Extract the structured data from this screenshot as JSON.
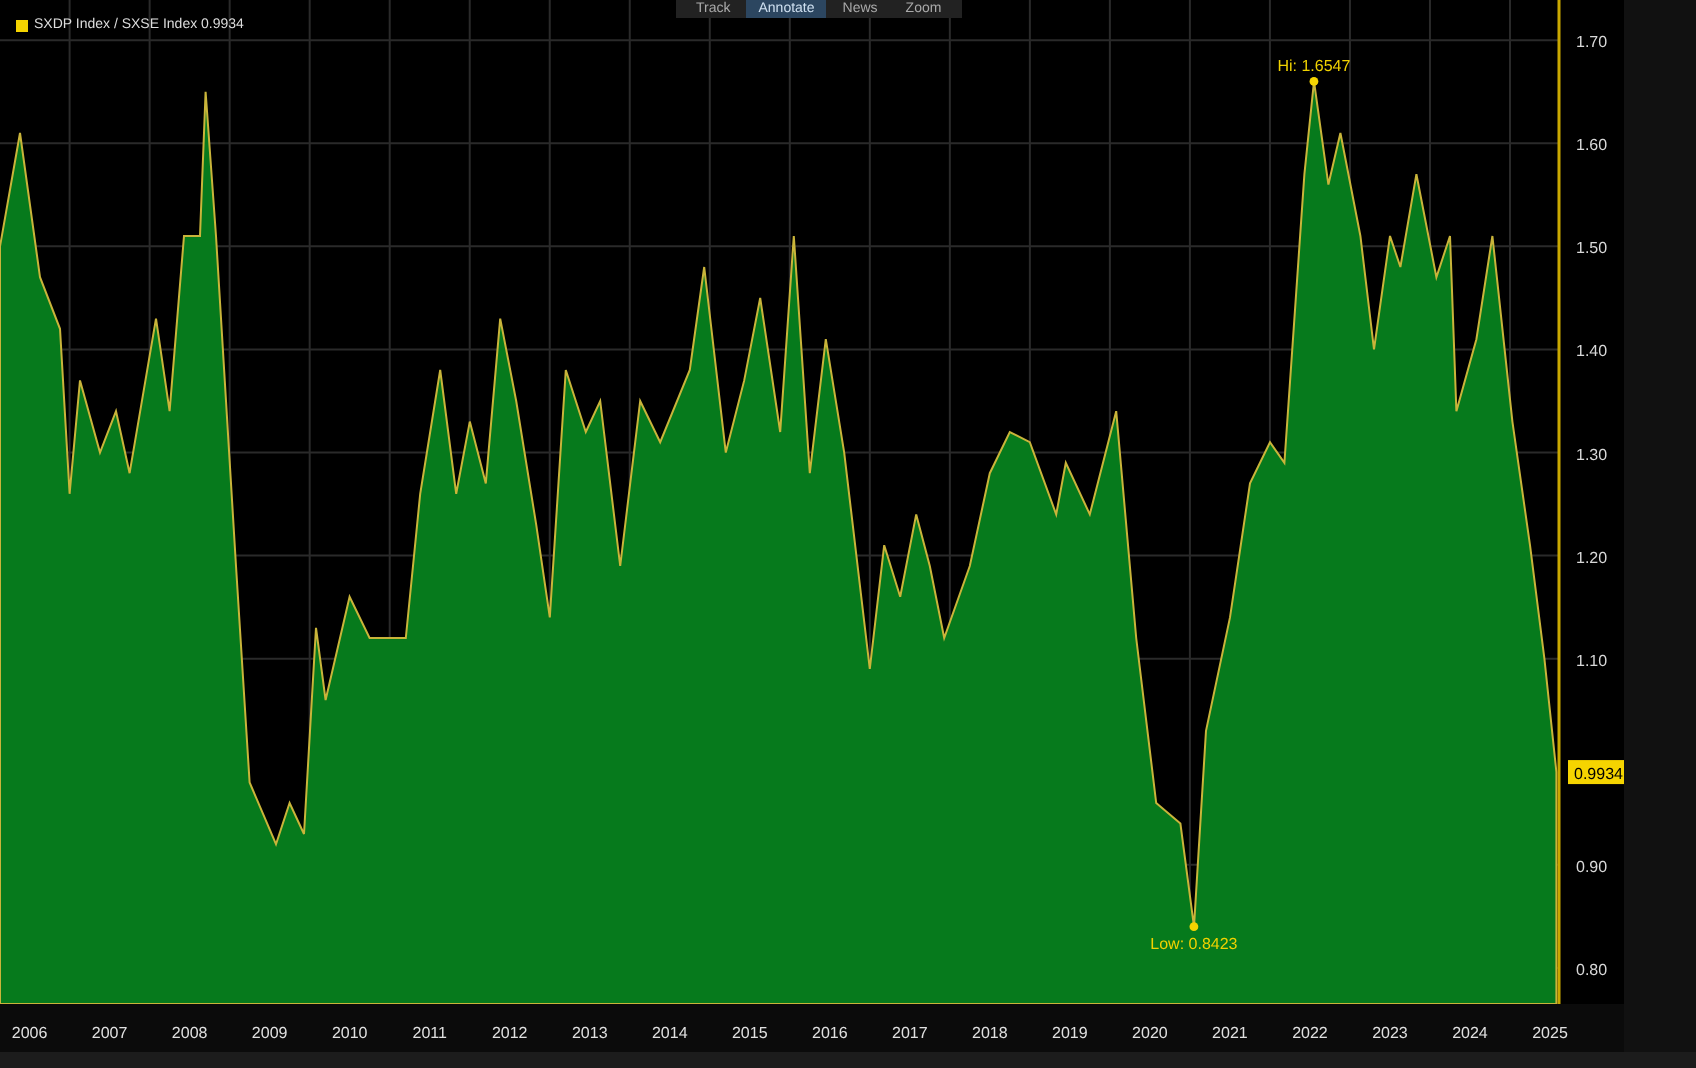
{
  "toolbar": {
    "buttons": [
      {
        "label": "Track",
        "selected": false
      },
      {
        "label": "Annotate",
        "selected": true
      },
      {
        "label": "News",
        "selected": false
      },
      {
        "label": "Zoom",
        "selected": false
      }
    ]
  },
  "legend": {
    "value": "0.9934"
  },
  "chart": {
    "last_value_label": "0.9934",
    "extreme_labels": [
      {
        "kind": "high",
        "label": "Hi: 1.6547"
      },
      {
        "kind": "low",
        "label": "Low: 0.8423"
      }
    ],
    "chart_data": {
      "type": "area",
      "grid": true,
      "x": [
        2006.13,
        2006.38,
        2006.63,
        2006.88,
        2007.0,
        2007.13,
        2007.38,
        2007.58,
        2007.75,
        2008.08,
        2008.25,
        2008.43,
        2008.63,
        2008.7,
        2008.83,
        2009.08,
        2009.25,
        2009.58,
        2009.75,
        2009.93,
        2010.08,
        2010.2,
        2010.5,
        2010.75,
        2011.2,
        2011.38,
        2011.63,
        2011.83,
        2012.0,
        2012.2,
        2012.38,
        2012.58,
        2012.83,
        2013.0,
        2013.2,
        2013.45,
        2013.63,
        2013.88,
        2014.13,
        2014.38,
        2014.75,
        2014.93,
        2015.2,
        2015.43,
        2015.63,
        2015.88,
        2016.05,
        2016.25,
        2016.45,
        2016.68,
        2017.0,
        2017.18,
        2017.38,
        2017.58,
        2017.75,
        2017.93,
        2018.25,
        2018.5,
        2018.75,
        2019.0,
        2019.33,
        2019.45,
        2019.75,
        2020.08,
        2020.33,
        2020.58,
        2020.88,
        2021.05,
        2021.2,
        2021.5,
        2021.75,
        2022.0,
        2022.18,
        2022.43,
        2022.55,
        2022.73,
        2022.88,
        2023.13,
        2023.3,
        2023.5,
        2023.63,
        2023.83,
        2024.08,
        2024.25,
        2024.33,
        2024.58,
        2024.78,
        2025.03,
        2025.25,
        2025.43,
        2025.58
      ],
      "series": [
        {
          "name": "SXDP Index / SXSE Index",
          "color": "#067a1c",
          "values": [
            1.5,
            1.61,
            1.47,
            1.42,
            1.26,
            1.37,
            1.3,
            1.34,
            1.28,
            1.43,
            1.34,
            1.51,
            1.51,
            1.65,
            1.51,
            1.19,
            0.98,
            0.92,
            0.96,
            0.93,
            1.13,
            1.06,
            1.16,
            1.12,
            1.12,
            1.26,
            1.38,
            1.26,
            1.33,
            1.27,
            1.43,
            1.35,
            1.23,
            1.14,
            1.38,
            1.32,
            1.35,
            1.19,
            1.35,
            1.31,
            1.38,
            1.48,
            1.3,
            1.37,
            1.45,
            1.32,
            1.51,
            1.28,
            1.41,
            1.3,
            1.09,
            1.21,
            1.16,
            1.24,
            1.19,
            1.12,
            1.19,
            1.28,
            1.32,
            1.31,
            1.24,
            1.29,
            1.24,
            1.34,
            1.12,
            0.96,
            0.94,
            0.84,
            1.03,
            1.14,
            1.27,
            1.31,
            1.29,
            1.57,
            1.66,
            1.56,
            1.61,
            1.51,
            1.4,
            1.51,
            1.48,
            1.57,
            1.47,
            1.51,
            1.34,
            1.41,
            1.51,
            1.33,
            1.21,
            1.1,
            0.99
          ]
        }
      ],
      "xlim": [
        2006.13,
        2025.6
      ],
      "ylim": [
        0.765,
        1.739
      ],
      "xticks": [
        {
          "value": 2006.5,
          "label": "2006"
        },
        {
          "value": 2007.5,
          "label": "2007"
        },
        {
          "value": 2008.5,
          "label": "2008"
        },
        {
          "value": 2009.5,
          "label": "2009"
        },
        {
          "value": 2010.5,
          "label": "2010"
        },
        {
          "value": 2011.5,
          "label": "2011"
        },
        {
          "value": 2012.5,
          "label": "2012"
        },
        {
          "value": 2013.5,
          "label": "2013"
        },
        {
          "value": 2014.5,
          "label": "2014"
        },
        {
          "value": 2015.5,
          "label": "2015"
        },
        {
          "value": 2016.5,
          "label": "2016"
        },
        {
          "value": 2017.5,
          "label": "2017"
        },
        {
          "value": 2018.5,
          "label": "2018"
        },
        {
          "value": 2019.5,
          "label": "2019"
        },
        {
          "value": 2020.5,
          "label": "2020"
        },
        {
          "value": 2021.5,
          "label": "2021"
        },
        {
          "value": 2022.5,
          "label": "2022"
        },
        {
          "value": 2023.5,
          "label": "2023"
        },
        {
          "value": 2024.5,
          "label": "2024"
        },
        {
          "value": 2025.5,
          "label": "2025"
        }
      ],
      "yticks": [
        {
          "value": 0.8,
          "label": "0.80"
        },
        {
          "value": 0.9,
          "label": "0.90"
        },
        {
          "value": 1.1,
          "label": "1.10"
        },
        {
          "value": 1.2,
          "label": "1.20"
        },
        {
          "value": 1.3,
          "label": "1.30"
        },
        {
          "value": 1.4,
          "label": "1.40"
        },
        {
          "value": 1.5,
          "label": "1.50"
        },
        {
          "value": 1.6,
          "label": "1.60"
        },
        {
          "value": 1.7,
          "label": "1.70"
        }
      ]
    }
  }
}
